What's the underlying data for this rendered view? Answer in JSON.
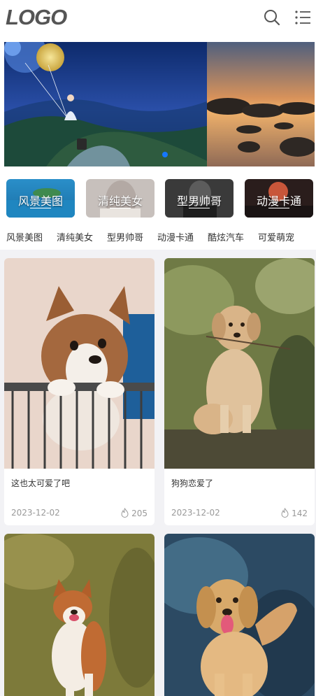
{
  "header": {
    "logo_text": "LOGO",
    "search_icon": "search-icon",
    "menu_icon": "list-menu-icon"
  },
  "banner": {
    "slide_count": 2,
    "active_slide": 1
  },
  "categories": [
    {
      "label": "风景美图"
    },
    {
      "label": "清纯美女"
    },
    {
      "label": "型男帅哥"
    },
    {
      "label": "动漫卡通"
    }
  ],
  "tabs": [
    {
      "label": "风景美图"
    },
    {
      "label": "清纯美女"
    },
    {
      "label": "型男帅哥"
    },
    {
      "label": "动漫卡通"
    },
    {
      "label": "酷炫汽车"
    },
    {
      "label": "可爱萌宠"
    }
  ],
  "posts": [
    {
      "title": "这也太可爱了吧",
      "date": "2023-12-02",
      "views": "205",
      "views_icon": "flame-icon"
    },
    {
      "title": "狗狗恋爱了",
      "date": "2023-12-02",
      "views": "142",
      "views_icon": "flame-icon"
    },
    {
      "title": "",
      "date": "",
      "views": ""
    },
    {
      "title": "",
      "date": "",
      "views": ""
    }
  ],
  "colors": {
    "accent": "#1677ff",
    "logo": "#555555",
    "text": "#333333",
    "muted": "#999999",
    "page_bg": "#f2f2f5"
  }
}
